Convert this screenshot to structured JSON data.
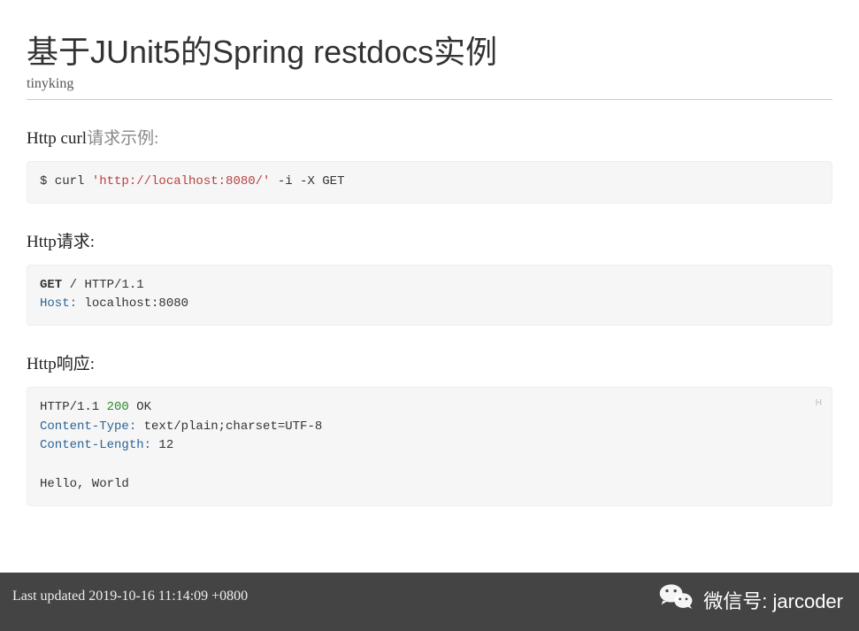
{
  "title": "基于JUnit5的Spring restdocs实例",
  "author": "tinyking",
  "sections": {
    "curl": {
      "heading_prefix": "Http curl",
      "heading_gray": "请求示例:",
      "code": {
        "prompt": "$ curl ",
        "url": "'http://localhost:8080/'",
        "flags": " -i -X GET"
      }
    },
    "request": {
      "heading_prefix": "Http",
      "heading_suffix": "请求:",
      "code": {
        "method": "GET",
        "path": " / ",
        "protocol": "HTTP/1.1",
        "host_label": "Host:",
        "host_value": " localhost:8080"
      }
    },
    "response": {
      "heading_prefix": "Http",
      "heading_suffix": "响应:",
      "badge": "H",
      "code": {
        "protocol": "HTTP/1.1 ",
        "status_code": "200",
        "status_text": " OK",
        "ctype_label": "Content-Type:",
        "ctype_value": " text/plain;charset=UTF-8",
        "clen_label": "Content-Length:",
        "clen_value": " 12",
        "body": "Hello, World"
      }
    }
  },
  "footer": {
    "last_updated": "Last updated 2019-10-16 11:14:09 +0800"
  },
  "wechat": {
    "label": "微信号: jarcoder"
  }
}
